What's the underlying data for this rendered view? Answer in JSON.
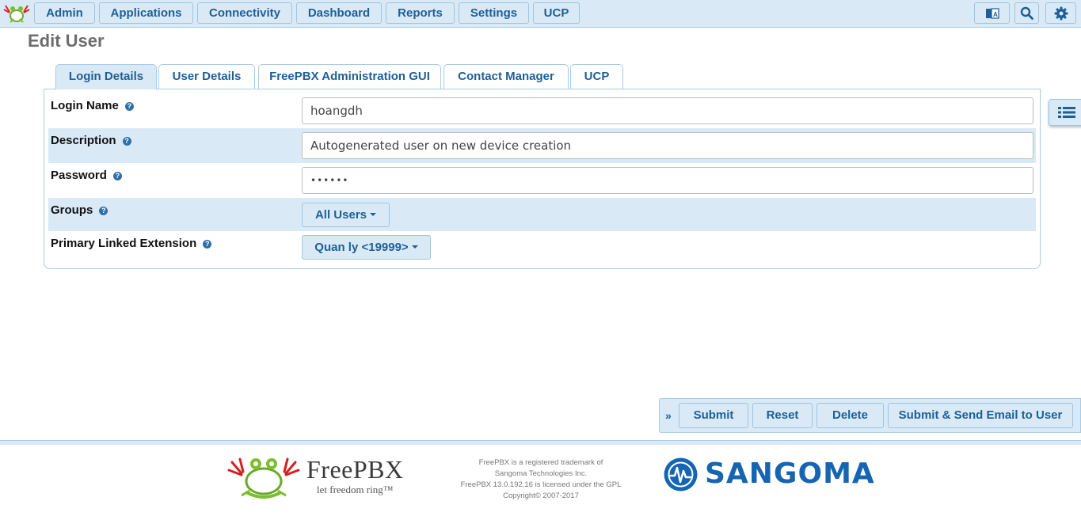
{
  "nav": {
    "items": [
      "Admin",
      "Applications",
      "Connectivity",
      "Dashboard",
      "Reports",
      "Settings",
      "UCP"
    ],
    "icons": [
      "translate-icon",
      "search-icon",
      "gear-icon"
    ]
  },
  "page": {
    "title": "Edit User"
  },
  "tabs": [
    "Login Details",
    "User Details",
    "FreePBX Administration GUI",
    "Contact Manager",
    "UCP"
  ],
  "active_tab": "Login Details",
  "form": {
    "login_name": {
      "label": "Login Name",
      "value": "hoangdh"
    },
    "description": {
      "label": "Description",
      "value": "Autogenerated user on new device creation"
    },
    "password": {
      "label": "Password",
      "value": "••••••"
    },
    "groups": {
      "label": "Groups",
      "value": "All Users"
    },
    "primary_extension": {
      "label": "Primary Linked Extension",
      "value": "Quan ly <19999>"
    }
  },
  "actions": {
    "collapse": "»",
    "submit": "Submit",
    "reset": "Reset",
    "delete": "Delete",
    "submit_email": "Submit & Send Email to User"
  },
  "footer": {
    "brand": "FreePBX",
    "tagline": "let freedom ring™",
    "legal": [
      "FreePBX is a registered trademark of",
      "Sangoma Technologies Inc.",
      "FreePBX 13.0.192.16 is licensed under the GPL",
      "Copyright© 2007-2017"
    ],
    "sangoma": "SANGOMA"
  },
  "colors": {
    "accent": "#1f5f97",
    "bar": "#d9eaf6",
    "sangoma": "#1565b2"
  }
}
